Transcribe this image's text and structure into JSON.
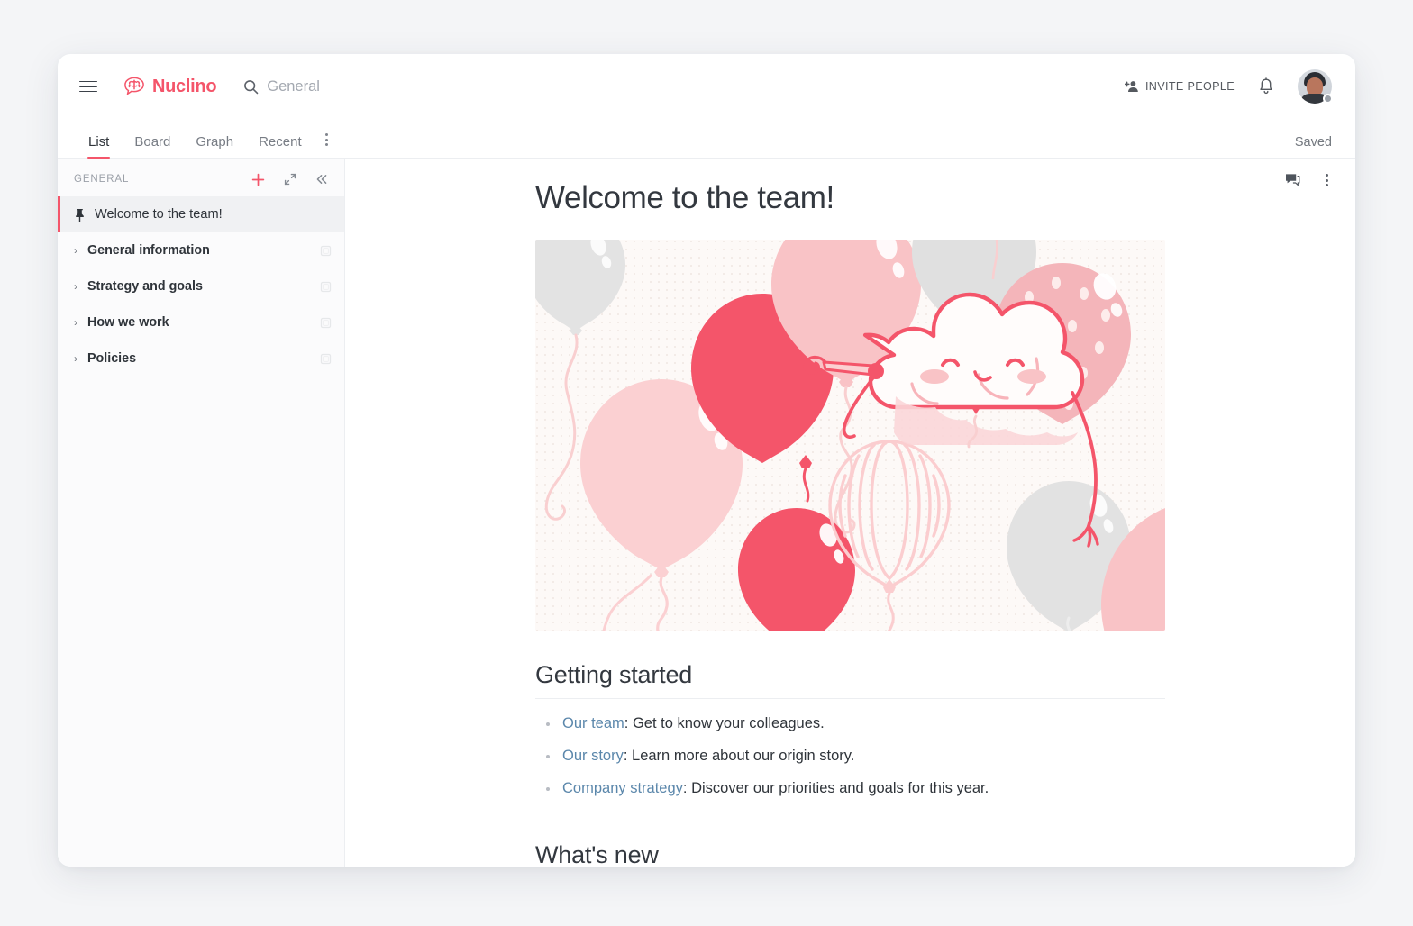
{
  "brand": {
    "name": "Nuclino",
    "accent": "#f4556a",
    "logo_icon": "brain-speech-bubble-icon"
  },
  "topbar": {
    "menu_icon": "hamburger-icon",
    "search": {
      "icon": "search-icon",
      "value": "",
      "placeholder": "General"
    },
    "invite": {
      "label": "INVITE PEOPLE",
      "icon": "person-add-icon"
    },
    "notifications_icon": "bell-icon",
    "avatar": {
      "name": "avatar",
      "status": "away",
      "status_color": "#9aa0a8"
    }
  },
  "tabbar": {
    "tabs": [
      {
        "label": "List",
        "active": true
      },
      {
        "label": "Board",
        "active": false
      },
      {
        "label": "Graph",
        "active": false
      },
      {
        "label": "Recent",
        "active": false
      }
    ],
    "overflow_icon": "kebab-menu-icon",
    "status": "Saved"
  },
  "sidebar": {
    "section_title": "GENERAL",
    "actions": [
      {
        "name": "add-item-button",
        "icon": "plus-icon",
        "color": "#f4556a"
      },
      {
        "name": "expand-button",
        "icon": "expand-arrows-icon"
      },
      {
        "name": "collapse-sidebar-button",
        "icon": "chevron-double-left-icon"
      }
    ],
    "items": [
      {
        "label": "Welcome to the team!",
        "icon": "pin-icon",
        "active": true,
        "bold": false,
        "caret": false
      },
      {
        "label": "General information",
        "icon": "cluster-icon",
        "active": false,
        "bold": true,
        "caret": true
      },
      {
        "label": "Strategy and goals",
        "icon": "cluster-icon",
        "active": false,
        "bold": true,
        "caret": true
      },
      {
        "label": "How we work",
        "icon": "cluster-icon",
        "active": false,
        "bold": true,
        "caret": true
      },
      {
        "label": "Policies",
        "icon": "cluster-icon",
        "active": false,
        "bold": true,
        "caret": true
      }
    ],
    "caret_glyph": "›"
  },
  "content": {
    "actions": [
      {
        "name": "comments-button",
        "icon": "comment-bubble-icon"
      },
      {
        "name": "document-menu-button",
        "icon": "kebab-menu-icon"
      }
    ],
    "title": "Welcome to the team!",
    "hero": {
      "name": "balloons-celebration-illustration",
      "alt": "Cloud mascot with party blower surrounded by balloons",
      "background": "#fdf8f6",
      "colors": {
        "red": "#f4556a",
        "pink": "#f9c3c6",
        "pink_light": "#fbd6d8",
        "gray": "#e2e2e2",
        "white": "#fffdfc"
      }
    },
    "sections": [
      {
        "heading": "Getting started",
        "bullets": [
          {
            "link": "Our team",
            "rest": ": Get to know your colleagues."
          },
          {
            "link": "Our story",
            "rest": ": Learn more about our origin story."
          },
          {
            "link": "Company strategy",
            "rest": ": Discover our priorities and goals for this year."
          }
        ]
      },
      {
        "heading": "What's new",
        "bullets": []
      }
    ],
    "link_color": "#5b87ab"
  }
}
